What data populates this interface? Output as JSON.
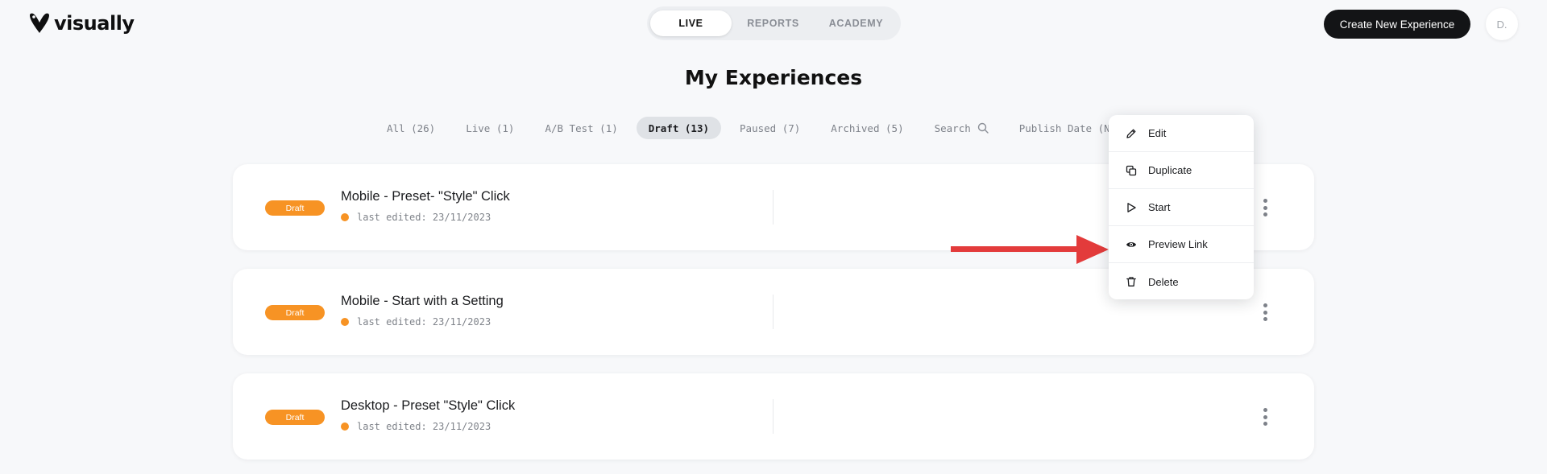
{
  "header": {
    "logo_text": "visually",
    "tabs": [
      "LIVE",
      "REPORTS",
      "ACADEMY"
    ],
    "active_tab": "LIVE",
    "create_button": "Create New Experience",
    "avatar_initial": "D."
  },
  "page": {
    "title": "My Experiences"
  },
  "filters": {
    "all": "All (26)",
    "live": "Live (1)",
    "ab_test": "A/B Test (1)",
    "draft": "Draft (13)",
    "paused": "Paused (7)",
    "archived": "Archived (5)",
    "search": "Search",
    "sort": "Publish Date (New-",
    "active": "Draft (13)"
  },
  "experiences": [
    {
      "badge": "Draft",
      "title": "Mobile - Preset- \"Style\" Click",
      "meta": "last edited: 23/11/2023"
    },
    {
      "badge": "Draft",
      "title": "Mobile - Start with a Setting",
      "meta": "last edited: 23/11/2023"
    },
    {
      "badge": "Draft",
      "title": "Desktop - Preset \"Style\" Click",
      "meta": "last edited: 23/11/2023"
    }
  ],
  "context_menu": {
    "items": [
      {
        "label": "Edit",
        "icon": "pencil-icon"
      },
      {
        "label": "Duplicate",
        "icon": "copy-icon"
      },
      {
        "label": "Start",
        "icon": "play-icon"
      },
      {
        "label": "Preview Link",
        "icon": "eye-icon"
      },
      {
        "label": "Delete",
        "icon": "trash-icon"
      }
    ]
  },
  "colors": {
    "draft_badge": "#f79324",
    "primary_button": "#131416",
    "annotation_arrow": "#e33b3b",
    "background": "#f7f8fa"
  }
}
